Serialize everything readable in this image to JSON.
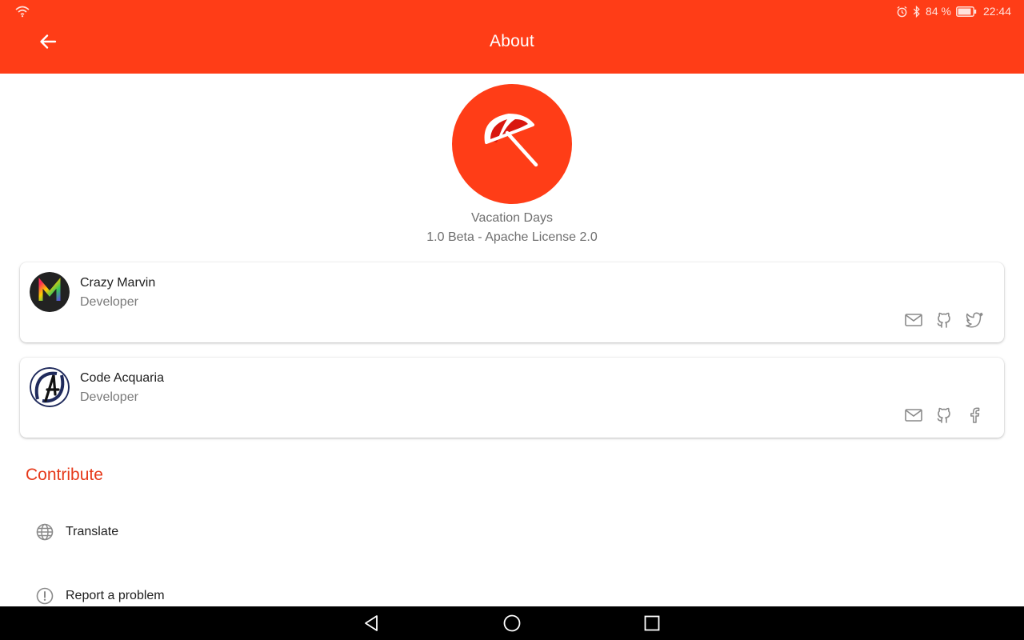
{
  "status_bar": {
    "battery_percent": "84 %",
    "time": "22:44",
    "icons": [
      "wifi-icon",
      "alarm-icon",
      "bluetooth-icon",
      "battery-icon"
    ]
  },
  "app_bar": {
    "title": "About",
    "back_icon": "arrow-left-icon"
  },
  "colors": {
    "primary": "#FF3D17",
    "accent_text": "#E6391A",
    "secondary_text": "#6F6F6F",
    "icon_gray": "#8A8A8A"
  },
  "app_info": {
    "logo_icon": "beach-umbrella-icon",
    "name": "Vacation Days",
    "version_license": "1.0 Beta - Apache License 2.0"
  },
  "developers": [
    {
      "name": "Crazy Marvin",
      "role": "Developer",
      "avatar": "crazy-marvin-avatar",
      "actions": [
        "mail-icon",
        "github-icon",
        "twitter-icon"
      ]
    },
    {
      "name": "Code Acquaria",
      "role": "Developer",
      "avatar": "code-acquaria-avatar",
      "actions": [
        "mail-icon",
        "github-icon",
        "facebook-icon"
      ]
    }
  ],
  "contribute": {
    "title": "Contribute",
    "items": [
      {
        "label": "Translate",
        "icon": "globe-icon"
      },
      {
        "label": "Report a problem",
        "icon": "alert-circle-icon"
      }
    ]
  },
  "nav_bar": {
    "buttons": [
      "nav-back-icon",
      "nav-home-icon",
      "nav-recents-icon"
    ]
  }
}
